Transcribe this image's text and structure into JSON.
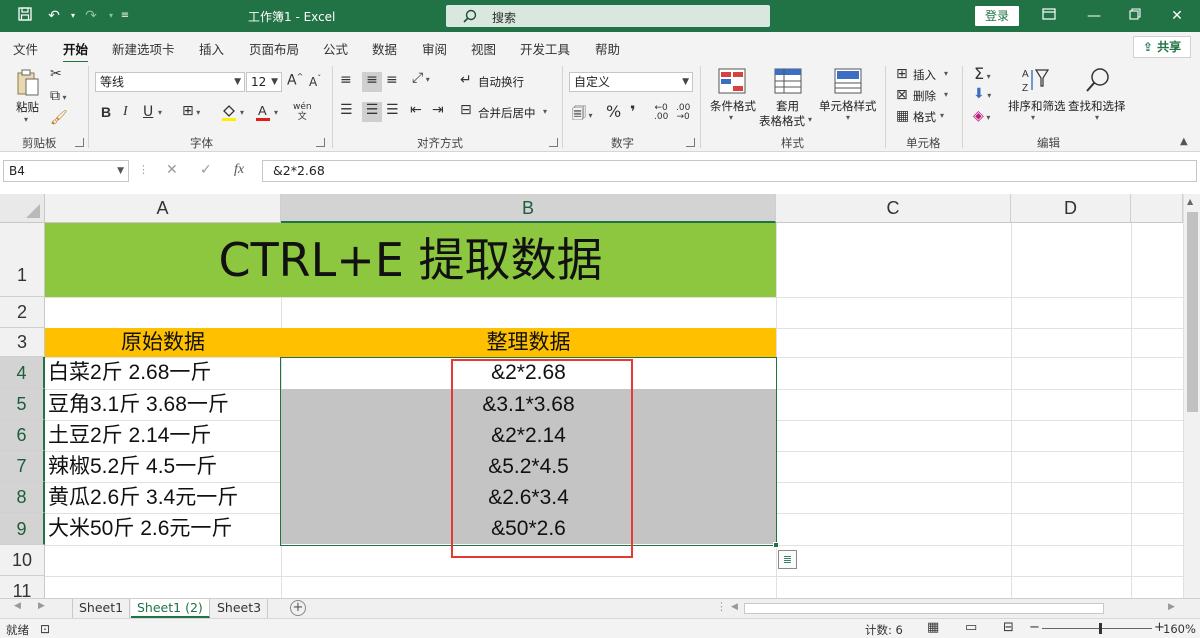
{
  "titlebar": {
    "title": "工作簿1  -  Excel",
    "search_placeholder": "搜索",
    "login_label": "登录"
  },
  "menu": {
    "tabs": [
      "文件",
      "开始",
      "新建选项卡",
      "插入",
      "页面布局",
      "公式",
      "数据",
      "审阅",
      "视图",
      "开发工具",
      "帮助"
    ],
    "active_tab": "开始",
    "share_label": "共享"
  },
  "ribbon": {
    "clipboard": {
      "paste_label": "粘贴",
      "group_label": "剪贴板"
    },
    "font": {
      "font_name": "等线",
      "font_size": "12",
      "bold": "B",
      "italic": "I",
      "underline": "U",
      "group_label": "字体"
    },
    "alignment": {
      "wrap_label": "自动换行",
      "merge_label": "合并后居中",
      "group_label": "对齐方式"
    },
    "number": {
      "format_value": "自定义",
      "percent": "%",
      "group_label": "数字"
    },
    "styles": {
      "conditional_label": "条件格式",
      "table_label_line1": "套用",
      "table_label_line2": "表格格式",
      "cell_styles_label": "单元格样式",
      "group_label": "样式"
    },
    "cells": {
      "insert_label": "插入",
      "delete_label": "删除",
      "format_label": "格式",
      "group_label": "单元格"
    },
    "editing": {
      "sort_label": "排序和筛选",
      "find_label": "查找和选择",
      "group_label": "编辑"
    }
  },
  "formula_bar": {
    "name_box": "B4",
    "fx": "fx",
    "formula": "&2*2.68"
  },
  "sheet": {
    "columns": [
      "A",
      "B",
      "C",
      "D"
    ],
    "rows": [
      "1",
      "2",
      "3",
      "4",
      "5",
      "6",
      "7",
      "8",
      "9",
      "10",
      "11"
    ],
    "title": "CTRL+E 提取数据",
    "header_a": "原始数据",
    "header_b": "整理数据",
    "data": [
      {
        "a": "白菜2斤 2.68一斤",
        "b": "&2*2.68"
      },
      {
        "a": "豆角3.1斤 3.68一斤",
        "b": "&3.1*3.68"
      },
      {
        "a": "土豆2斤 2.14一斤",
        "b": "&2*2.14"
      },
      {
        "a": "辣椒5.2斤 4.5一斤",
        "b": "&5.2*4.5"
      },
      {
        "a": "黄瓜2.6斤 3.4元一斤",
        "b": "&2.6*3.4"
      },
      {
        "a": "大米50斤 2.6元一斤",
        "b": "&50*2.6"
      }
    ]
  },
  "tabs": {
    "sheets": [
      "Sheet1",
      "Sheet1 (2)",
      "Sheet3"
    ],
    "active": "Sheet1 (2)"
  },
  "status": {
    "ready": "就绪",
    "count": "计数: 6",
    "zoom": "160%"
  },
  "colors": {
    "excel_green": "#217346",
    "title_fill": "#8dc63f",
    "header_fill": "#ffc000",
    "selection_fill": "#c4c4c4",
    "highlight_box": "#e53935"
  }
}
